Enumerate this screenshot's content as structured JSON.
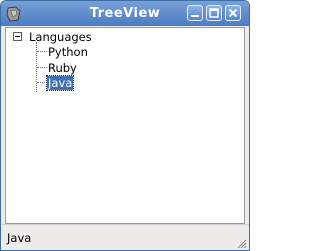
{
  "window": {
    "title": "TreeView"
  },
  "tree": {
    "root_label": "Languages",
    "children": [
      "Python",
      "Ruby",
      "Java"
    ],
    "selected_index": 2
  },
  "statusbar": {
    "text": "Java"
  },
  "colors": {
    "titlebar": "#4a7cc4",
    "selection": "#3f6fb5"
  },
  "icons": [
    "app-icon",
    "minimize-icon",
    "maximize-icon",
    "close-icon",
    "collapse-icon",
    "resize-grip-icon"
  ]
}
